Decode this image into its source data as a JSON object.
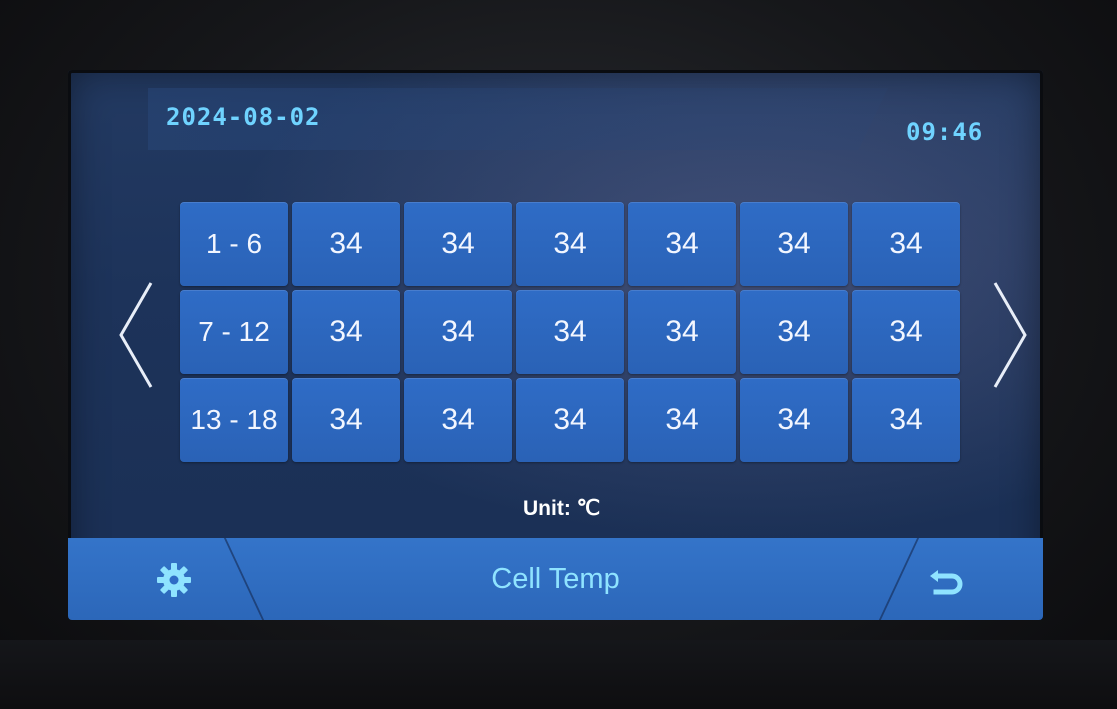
{
  "header": {
    "date": "2024-08-02",
    "time": "09:46"
  },
  "temperature_grid": {
    "rows": [
      {
        "label": "1 - 6",
        "values": [
          "34",
          "34",
          "34",
          "34",
          "34",
          "34"
        ]
      },
      {
        "label": "7 - 12",
        "values": [
          "34",
          "34",
          "34",
          "34",
          "34",
          "34"
        ]
      },
      {
        "label": "13 - 18",
        "values": [
          "34",
          "34",
          "34",
          "34",
          "34",
          "34"
        ]
      }
    ]
  },
  "unit_label": "Unit: ℃",
  "footer": {
    "title": "Cell Temp",
    "settings_icon": "gear-icon",
    "back_icon": "back-arrow-icon"
  },
  "navigation": {
    "prev_icon": "chevron-left-icon",
    "next_icon": "chevron-right-icon"
  },
  "colors": {
    "screen_bg": "#1d335a",
    "cell_bg": "#2f6cc6",
    "accent_text": "#6fd3ff",
    "title_text": "#8fe3ff",
    "bottom_bar": "#3474c9"
  }
}
